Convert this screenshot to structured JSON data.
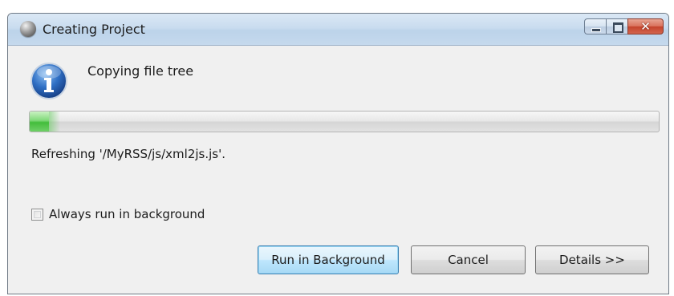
{
  "window": {
    "title": "Creating Project",
    "icon": "eclipse-sphere-icon",
    "caption_buttons": [
      "minimize",
      "maximize",
      "close"
    ]
  },
  "dialog": {
    "icon": "info-icon",
    "message": "Copying file tree",
    "progress_fraction": 0.03,
    "status_text": "Refreshing '/MyRSS/js/xml2js.js'.",
    "checkbox": {
      "label": "Always run in background",
      "checked": false
    }
  },
  "buttons": {
    "run_in_background": "Run in Background",
    "cancel": "Cancel",
    "details": "Details >>"
  },
  "colors": {
    "titlebar": "#c9dcef",
    "progress_green": "#43bd3c",
    "close_red": "#c4432c",
    "default_button_border": "#3c7fb1",
    "info_blue": "#2a5fae"
  }
}
